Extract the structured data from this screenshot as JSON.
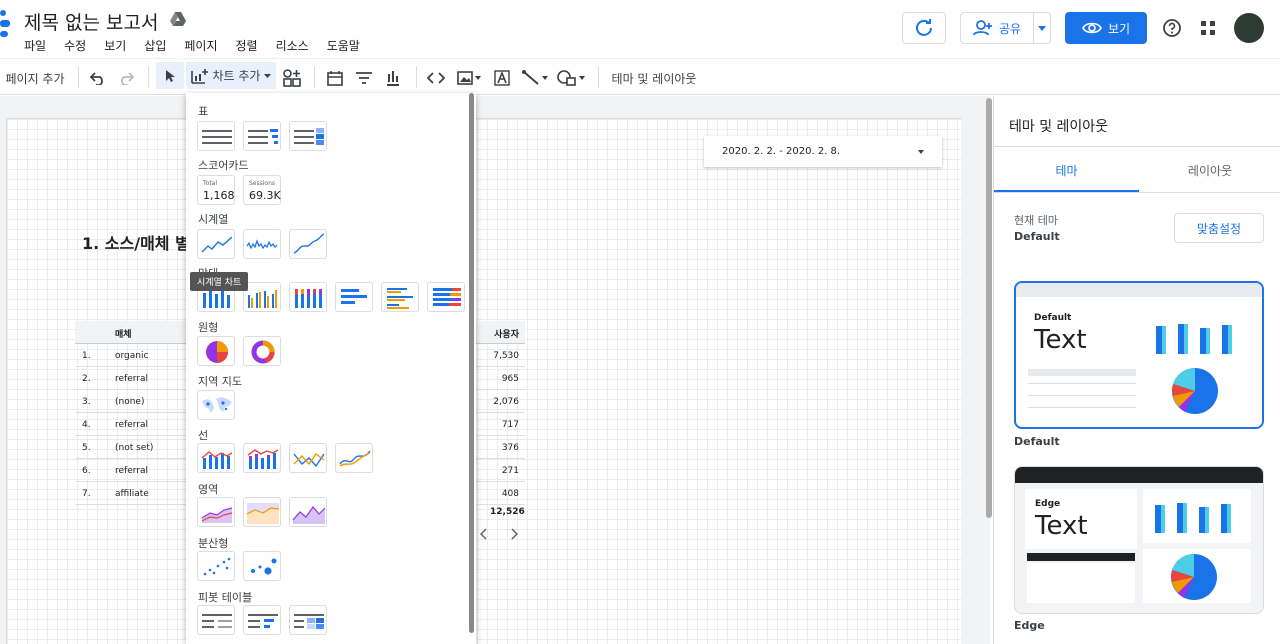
{
  "header": {
    "title": "제목 없는 보고서",
    "share_label": "공유",
    "view_label": "보기",
    "menu": [
      "파일",
      "수정",
      "보기",
      "삽입",
      "페이지",
      "정렬",
      "리소스",
      "도움말"
    ]
  },
  "toolbar": {
    "add_page": "페이지 추가",
    "add_chart": "차트 추가",
    "theme_layout": "테마 및 레이아웃"
  },
  "canvas": {
    "date_range": "2020. 2. 2. - 2020. 2. 8.",
    "report_heading": "1. 소스/매체 별",
    "table": {
      "col_medium": "매체",
      "col_users": "사용자",
      "rows": [
        {
          "n": "1.",
          "medium": "organic",
          "users": "7,530"
        },
        {
          "n": "2.",
          "medium": "referral",
          "users": "965"
        },
        {
          "n": "3.",
          "medium": "(none)",
          "users": "2,076"
        },
        {
          "n": "4.",
          "medium": "referral",
          "users": "717"
        },
        {
          "n": "5.",
          "medium": "(not set)",
          "users": "376"
        },
        {
          "n": "6.",
          "medium": "referral",
          "users": "271"
        },
        {
          "n": "7.",
          "medium": "affiliate",
          "users": "408"
        }
      ],
      "total": "12,526"
    }
  },
  "chart_menu": {
    "sections": [
      "표",
      "스코어카드",
      "시계열",
      "막대",
      "원형",
      "지역 지도",
      "선",
      "영역",
      "분산형",
      "피봇 테이블"
    ],
    "scorecard_total_label": "Total",
    "scorecard_total_value": "1,168",
    "scorecard_sessions_label": "Sessions",
    "scorecard_sessions_value": "69.3K",
    "tooltip": "시계열 차트"
  },
  "right_panel": {
    "title": "테마 및 레이아웃",
    "tab_theme": "테마",
    "tab_layout": "레이아웃",
    "current_theme_label": "현재 테마",
    "current_theme_value": "Default",
    "customize_button": "맞춤설정",
    "theme1_name": "Default",
    "theme1_caption": "Default",
    "theme1_text": "Text",
    "theme2_name": "Edge",
    "theme2_caption": "Edge",
    "theme2_text": "Text"
  },
  "colors": {
    "accent": "#1a73e8"
  }
}
